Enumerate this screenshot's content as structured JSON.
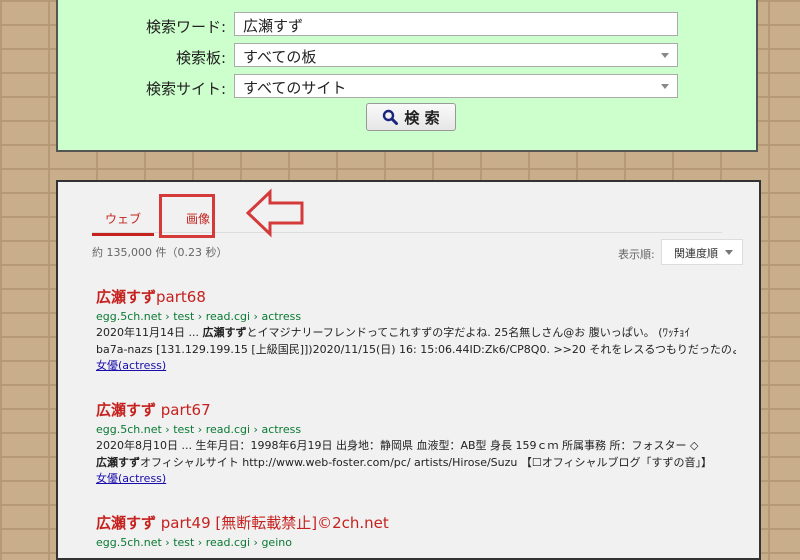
{
  "search_form": {
    "keyword_label": "検索ワード:",
    "keyword_value": "広瀬すず",
    "board_label": "検索板:",
    "board_value": "すべての板",
    "site_label": "検索サイト:",
    "site_value": "すべてのサイト",
    "button_label": "検 索"
  },
  "results_panel": {
    "tabs": {
      "web": "ウェブ",
      "images": "画像"
    },
    "count": "約 135,000 件（0.23 秒）",
    "sort_label": "表示順:",
    "sort_value": "関連度順",
    "accent_color": "#c5221f"
  },
  "results": [
    {
      "title_bold": "広瀬すず",
      "title_rest": "part68",
      "url": "egg.5ch.net › test › read.cgi › actress",
      "date": "2020年11月14日 ... ",
      "snippet_line1_bold": "広瀬すず",
      "snippet_line1_rest": "とイマジナリーフレンドってこれすずの字だよね. 25名無しさん@お 腹いっぱい。 (ﾜｯﾁｮｲ",
      "snippet_line2": "ba7a-nazs [131.129.199.15 [上級国民]])2020/11/15(日) 16: 15:06.44ID:Zk6/CP8Q0. >>20 それをレスるつもりだったのよ",
      "tag": "女優(actress)"
    },
    {
      "title_bold": "広瀬すず",
      "title_rest": " part67",
      "url": "egg.5ch.net › test › read.cgi › actress",
      "date": "2020年8月10日 ... ",
      "snippet_line1_rest": "生年月日：1998年6月19日 出身地：静岡県 血液型：AB型 身長 159ｃｍ 所属事務 所：フォスター ◇",
      "snippet_line2_bold": "広瀬すず",
      "snippet_line2_rest": "オフィシャルサイト http://www.web-foster.com/pc/ artists/Hirose/Suzu 【☐オフィシャルブログ「すずの音」】",
      "tag": "女優(actress)"
    },
    {
      "title_bold": "広瀬すず",
      "title_rest": " part49 [無断転載禁止]©2ch.net",
      "url": "egg.5ch.net › test › read.cgi › geino"
    }
  ]
}
